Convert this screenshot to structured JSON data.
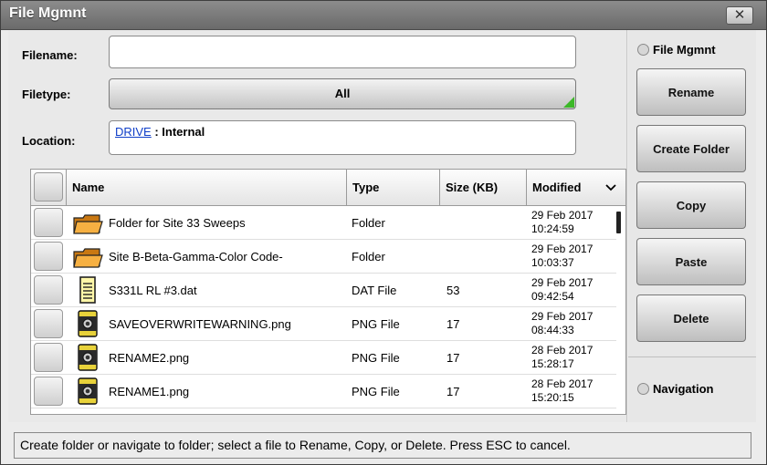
{
  "window": {
    "title": "File Mgmnt",
    "close_glyph": "✕"
  },
  "form": {
    "filename_label": "Filename:",
    "filename_value": "",
    "filetype_label": "Filetype:",
    "filetype_value": "All",
    "location_label": "Location:",
    "location_link": "DRIVE",
    "location_separator": " : ",
    "location_value": "Internal"
  },
  "table": {
    "columns": {
      "name": "Name",
      "type": "Type",
      "size": "Size (KB)",
      "modified": "Modified"
    },
    "rows": [
      {
        "icon": "folder-icon",
        "name": "Folder for Site 33 Sweeps",
        "type": "Folder",
        "size": "",
        "date": "29 Feb 2017",
        "time": "10:24:59"
      },
      {
        "icon": "folder-icon",
        "name": "Site B-Beta-Gamma-Color Code-",
        "type": "Folder",
        "size": "",
        "date": "29 Feb 2017",
        "time": "10:03:37"
      },
      {
        "icon": "document-icon",
        "name": "S331L RL #3.dat",
        "type": "DAT File",
        "size": "53",
        "date": "29 Feb 2017",
        "time": "09:42:54"
      },
      {
        "icon": "image-file-icon",
        "name": "SAVEOVERWRITEWARNING.png",
        "type": "PNG File",
        "size": "17",
        "date": "29 Feb 2017",
        "time": "08:44:33"
      },
      {
        "icon": "image-file-icon",
        "name": "RENAME2.png",
        "type": "PNG File",
        "size": "17",
        "date": "28 Feb 2017",
        "time": "15:28:17"
      },
      {
        "icon": "image-file-icon",
        "name": "RENAME1.png",
        "type": "PNG File",
        "size": "17",
        "date": "28 Feb 2017",
        "time": "15:20:15"
      }
    ]
  },
  "sidebar": {
    "title": "File Mgmnt",
    "buttons": [
      "Rename",
      "Create Folder",
      "Copy",
      "Paste",
      "Delete"
    ],
    "navigation": "Navigation"
  },
  "status": "Create folder or navigate to folder; select a file to Rename, Copy, or Delete. Press ESC to cancel.",
  "colors": {
    "accent_corner": "#3cb828",
    "link": "#0f3ec8",
    "folder": "#f5a623"
  }
}
